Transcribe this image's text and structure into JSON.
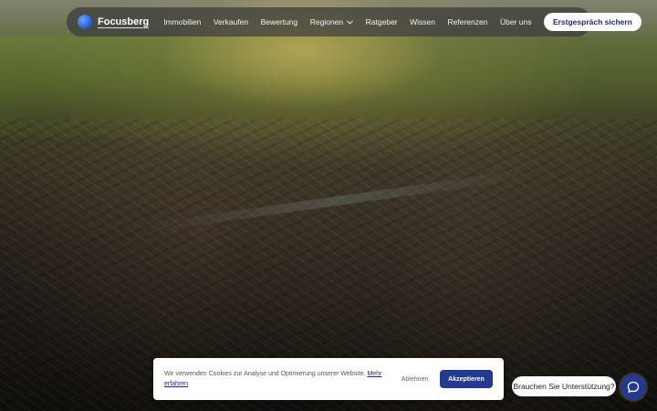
{
  "brand": {
    "name": "Focusberg"
  },
  "nav": {
    "items": [
      {
        "label": "Immobilien"
      },
      {
        "label": "Verkaufen"
      },
      {
        "label": "Bewertung"
      },
      {
        "label": "Regionen",
        "has_dropdown": true
      },
      {
        "label": "Ratgeber"
      },
      {
        "label": "Wissen"
      },
      {
        "label": "Referenzen"
      },
      {
        "label": "Über uns"
      }
    ],
    "cta_label": "Erstgespräch sichern"
  },
  "cookie": {
    "text": "Wir verwenden Cookies zur Analyse und Optimierung unserer Website.",
    "link_label": "Mehr erfahren",
    "decline_label": "Ablehnen",
    "accept_label": "Akzeptieren"
  },
  "support": {
    "bubble_label": "Brauchen Sie Unterstützung?",
    "icon": "chat-icon"
  },
  "colors": {
    "accent": "#243a8c",
    "cta_text": "#1f2a6e"
  }
}
